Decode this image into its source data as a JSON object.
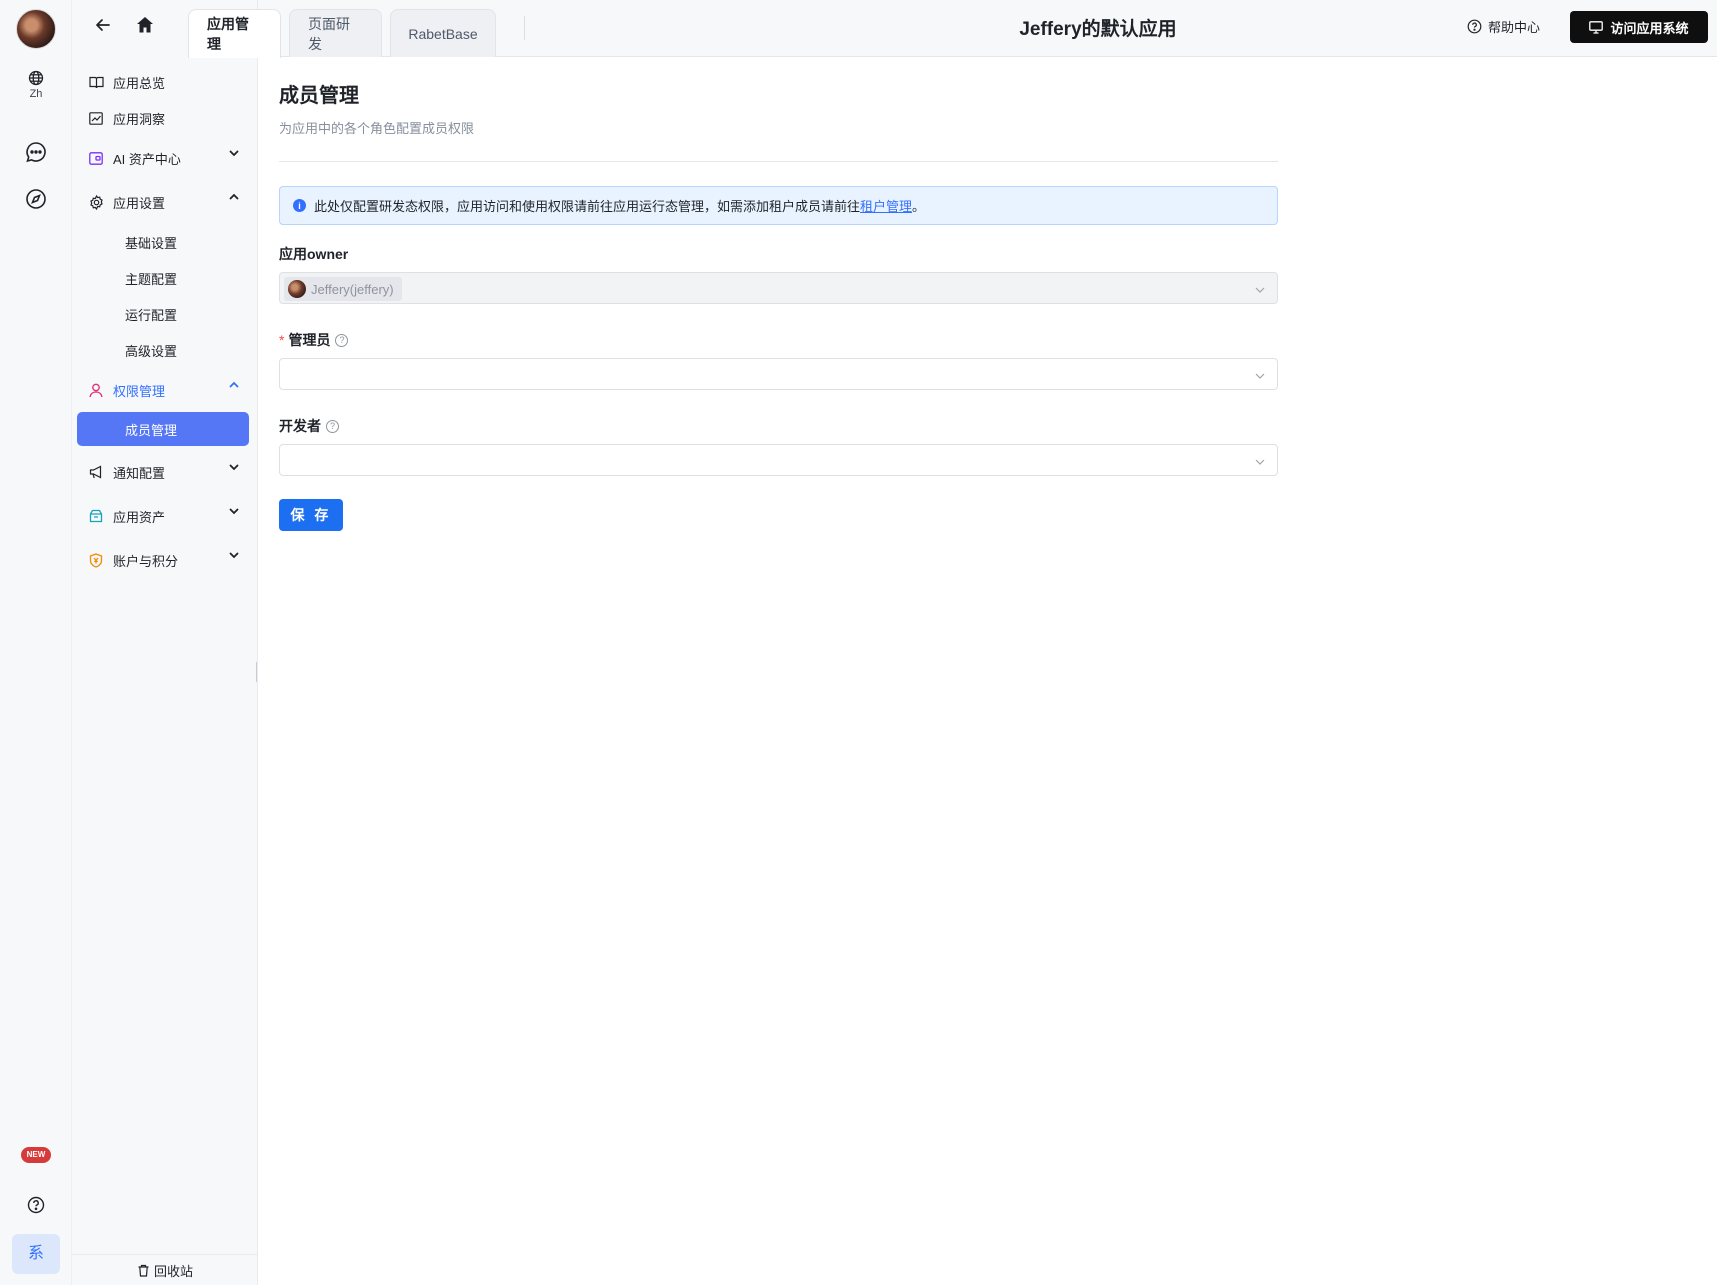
{
  "rail": {
    "language_label": "Zh",
    "new_badge": "NEW",
    "system_button": "系"
  },
  "sidebar": {
    "items": [
      {
        "label": "应用总览"
      },
      {
        "label": "应用洞察"
      },
      {
        "label": "AI 资产中心"
      },
      {
        "label": "应用设置"
      },
      {
        "label": "权限管理"
      },
      {
        "label": "通知配置"
      },
      {
        "label": "应用资产"
      },
      {
        "label": "账户与积分"
      }
    ],
    "app_settings_children": [
      "基础设置",
      "主题配置",
      "运行配置",
      "高级设置"
    ],
    "permission_children": [
      "成员管理"
    ],
    "recycle_label": "回收站"
  },
  "topbar": {
    "tabs": [
      {
        "label": "应用管理",
        "active": true
      },
      {
        "label": "页面研发",
        "active": false
      },
      {
        "label": "RabetBase",
        "active": false
      }
    ],
    "app_title": "Jeffery的默认应用",
    "help_label": "帮助中心",
    "visit_label": "访问应用系统"
  },
  "main": {
    "title": "成员管理",
    "subtitle": "为应用中的各个角色配置成员权限",
    "alert_text": "此处仅配置研发态权限，应用访问和使用权限请前往应用运行态管理，如需添加租户成员请前往",
    "alert_link": "租户管理",
    "alert_end": "。",
    "owner_label": "应用owner",
    "owner_value": "Jeffery(jeffery)",
    "admin_required": "*",
    "admin_label": "管理员",
    "developer_label": "开发者",
    "save_label": "保 存"
  },
  "colors": {
    "accent": "#3370ff",
    "selected_menu": "#5577f5",
    "primary_button": "#1d6ff2",
    "visit_button": "#0f0f0f",
    "alert_bg": "#e8f3ff"
  }
}
